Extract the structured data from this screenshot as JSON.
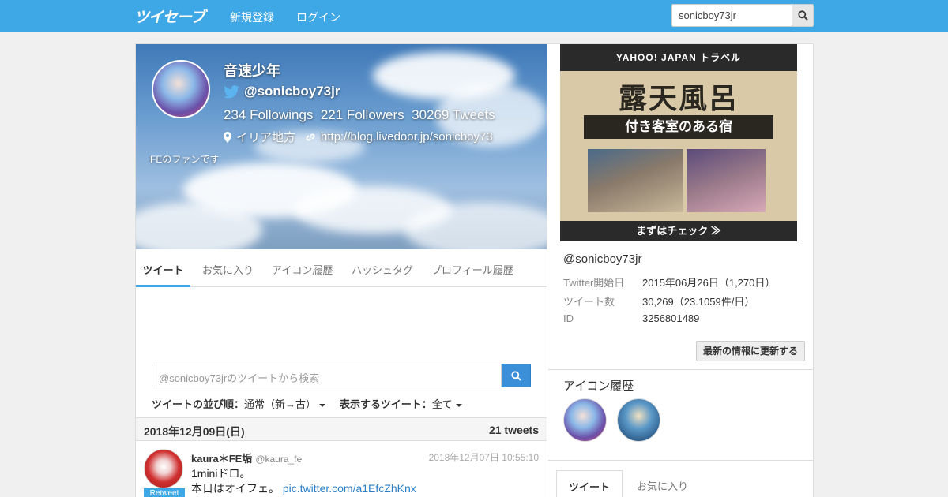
{
  "nav": {
    "logo": "ツイセーブ",
    "links": [
      "新規登録",
      "ログイン"
    ],
    "search_value": "sonicboy73jr"
  },
  "profile": {
    "name": "音速少年",
    "handle": "@sonicboy73jr",
    "stats": "234 Followings  221 Followers  30269 Tweets",
    "location": "イリア地方",
    "url": "http://blog.livedoor.jp/sonicboy73",
    "bio": "FEのファンです"
  },
  "tabs": [
    "ツイート",
    "お気に入り",
    "アイコン履歴",
    "ハッシュタグ",
    "プロフィール履歴"
  ],
  "tweet_search": {
    "placeholder": "@sonicboy73jrのツイートから検索"
  },
  "sort": {
    "order_label": "ツイートの並び順：",
    "order_value": "通常（新→古）",
    "show_label": "表示するツイート：",
    "show_value": "全て"
  },
  "date_bar": {
    "date": "2018年12月09日(日)",
    "count": "21 tweets"
  },
  "tweet": {
    "name": "kaura＊FE垢",
    "handle": "@kaura_fe",
    "time": "2018年12月07日 10:55:10",
    "line1": "1miniドロ。",
    "line2": "本日はオイフェ。",
    "link": "pic.twitter.com/a1EfcZhKnx",
    "badge": "Retweet"
  },
  "ad": {
    "brand": "YAHOO! JAPAN トラベル",
    "title": "露天風呂",
    "subtitle": "付き客室のある宿",
    "cta": "まずはチェック ≫"
  },
  "sidebar": {
    "handle": "@sonicboy73jr",
    "info": [
      {
        "key": "Twitter開始日",
        "value": "2015年06月26日（1,270日）"
      },
      {
        "key": "ツイート数",
        "value": "30,269（23.1059件/日）"
      },
      {
        "key": "ID",
        "value": "3256801489"
      }
    ],
    "refresh_label": "最新の情報に更新する",
    "icon_history_title": "アイコン履歴",
    "tabs": [
      "ツイート",
      "お気に入り"
    ]
  }
}
